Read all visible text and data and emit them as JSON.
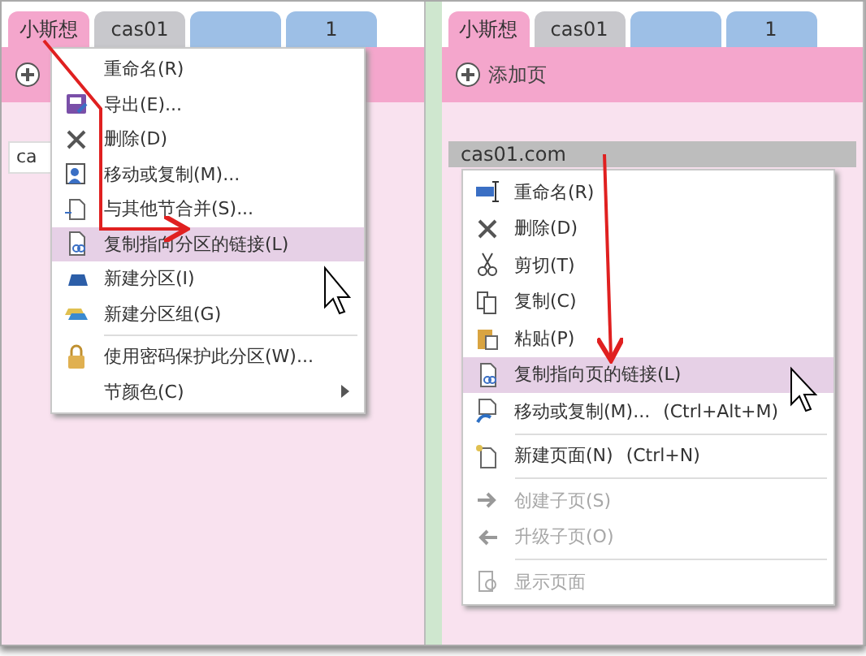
{
  "left_panel": {
    "tabs": [
      {
        "label": "小斯想",
        "selected": true,
        "color": "#f4a6cc"
      },
      {
        "label": "cas01",
        "selected": false,
        "color": "#c8c8cc"
      },
      {
        "selected": false,
        "color": "#9dbfe6"
      },
      {
        "label": "1",
        "selected": false,
        "color": "#9dbfe6"
      }
    ],
    "page_field": {
      "value": "ca"
    },
    "context_menu": {
      "items": [
        {
          "kind": "item",
          "label": "重命名(R)",
          "highlighted": false,
          "disabled": false
        },
        {
          "kind": "item",
          "label": "导出(E)...",
          "highlighted": false,
          "disabled": false
        },
        {
          "kind": "item",
          "label": "删除(D)",
          "highlighted": false,
          "disabled": false
        },
        {
          "kind": "item",
          "label": "移动或复制(M)...",
          "highlighted": false,
          "disabled": false
        },
        {
          "kind": "item",
          "label": "与其他节合并(S)...",
          "highlighted": false,
          "disabled": false
        },
        {
          "kind": "item",
          "label": "复制指向分区的链接(L)",
          "highlighted": true,
          "disabled": false
        },
        {
          "kind": "item",
          "label": "新建分区(I)",
          "highlighted": false,
          "disabled": false
        },
        {
          "kind": "item",
          "label": "新建分区组(G)",
          "highlighted": false,
          "disabled": false
        },
        {
          "kind": "separator"
        },
        {
          "kind": "item",
          "label": "使用密码保护此分区(W)...",
          "highlighted": false,
          "disabled": false
        },
        {
          "kind": "submenu",
          "label": "节颜色(C)",
          "highlighted": false,
          "disabled": false
        }
      ]
    }
  },
  "right_panel": {
    "tabs": [
      {
        "label": "小斯想",
        "selected": true,
        "color": "#f4a6cc"
      },
      {
        "label": "cas01",
        "selected": false,
        "color": "#c8c8cc"
      },
      {
        "selected": false,
        "color": "#9dbfe6"
      },
      {
        "label": "1",
        "selected": false,
        "color": "#9dbfe6"
      }
    ],
    "add_page": {
      "label": "添加页"
    },
    "pages": [
      {
        "title": "cas01.com",
        "selected": true
      }
    ],
    "context_menu": {
      "items": [
        {
          "kind": "item",
          "label": "重命名(R)",
          "highlighted": false,
          "disabled": false
        },
        {
          "kind": "item",
          "label": "删除(D)",
          "highlighted": false,
          "disabled": false
        },
        {
          "kind": "item",
          "label": "剪切(T)",
          "highlighted": false,
          "disabled": false
        },
        {
          "kind": "item",
          "label": "复制(C)",
          "highlighted": false,
          "disabled": false
        },
        {
          "kind": "item",
          "label": "粘贴(P)",
          "highlighted": false,
          "disabled": false
        },
        {
          "kind": "item",
          "label": "复制指向页的链接(L)",
          "highlighted": true,
          "disabled": false
        },
        {
          "kind": "item",
          "label": "移动或复制(M)...",
          "shortcut": "(Ctrl+Alt+M)",
          "highlighted": false,
          "disabled": false
        },
        {
          "kind": "separator"
        },
        {
          "kind": "item",
          "label": "新建页面(N)",
          "shortcut": "(Ctrl+N)",
          "highlighted": false,
          "disabled": false
        },
        {
          "kind": "separator"
        },
        {
          "kind": "item",
          "label": "创建子页(S)",
          "highlighted": false,
          "disabled": true
        },
        {
          "kind": "item",
          "label": "升级子页(O)",
          "highlighted": false,
          "disabled": true
        },
        {
          "kind": "separator"
        },
        {
          "kind": "item",
          "label": "显示页面",
          "highlighted": false,
          "disabled": true
        }
      ]
    }
  }
}
